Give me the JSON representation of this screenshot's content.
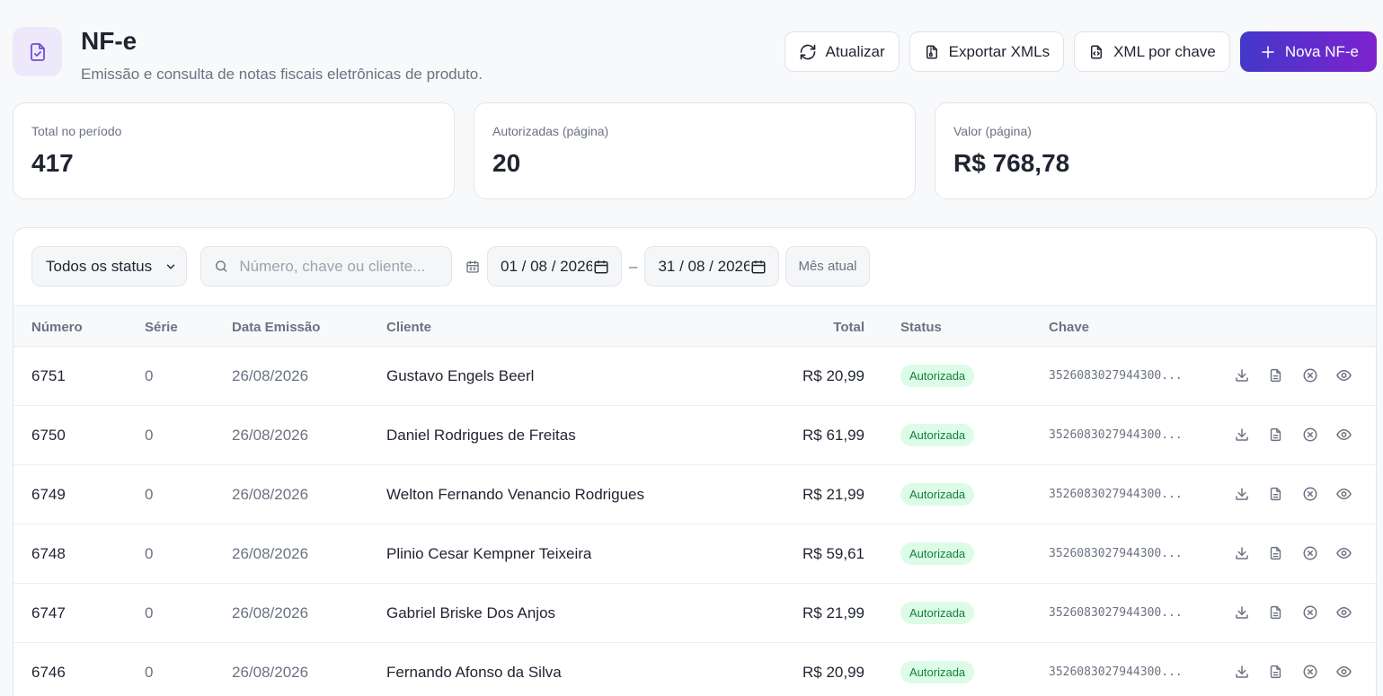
{
  "header": {
    "title": "NF-e",
    "subtitle": "Emissão e consulta de notas fiscais eletrônicas de produto.",
    "icon": "file-check-icon"
  },
  "actions": {
    "refresh_label": "Atualizar",
    "export_label": "Exportar XMLs",
    "xml_key_label": "XML por chave",
    "new_label": "Nova NF-e"
  },
  "stats": [
    {
      "label": "Total no período",
      "value": "417"
    },
    {
      "label": "Autorizadas (página)",
      "value": "20"
    },
    {
      "label": "Valor (página)",
      "value": "R$ 768,78"
    }
  ],
  "filters": {
    "status_selected": "Todos os status",
    "search_placeholder": "Número, chave ou cliente...",
    "date_from": "01 / 08 / 2026",
    "date_separator": "–",
    "date_to": "31 / 08 / 2026",
    "month_button": "Mês atual"
  },
  "table": {
    "columns": {
      "numero": "Número",
      "serie": "Série",
      "data": "Data Emissão",
      "cliente": "Cliente",
      "total": "Total",
      "status": "Status",
      "chave": "Chave"
    },
    "rows": [
      {
        "numero": "6751",
        "serie": "0",
        "data": "26/08/2026",
        "cliente": "Gustavo Engels Beerl",
        "total": "R$ 20,99",
        "status": "Autorizada",
        "chave": "3526083027944300..."
      },
      {
        "numero": "6750",
        "serie": "0",
        "data": "26/08/2026",
        "cliente": "Daniel Rodrigues de Freitas",
        "total": "R$ 61,99",
        "status": "Autorizada",
        "chave": "3526083027944300..."
      },
      {
        "numero": "6749",
        "serie": "0",
        "data": "26/08/2026",
        "cliente": "Welton Fernando Venancio Rodrigues",
        "total": "R$ 21,99",
        "status": "Autorizada",
        "chave": "3526083027944300..."
      },
      {
        "numero": "6748",
        "serie": "0",
        "data": "26/08/2026",
        "cliente": "Plinio Cesar Kempner Teixeira",
        "total": "R$ 59,61",
        "status": "Autorizada",
        "chave": "3526083027944300..."
      },
      {
        "numero": "6747",
        "serie": "0",
        "data": "26/08/2026",
        "cliente": "Gabriel Briske Dos Anjos",
        "total": "R$ 21,99",
        "status": "Autorizada",
        "chave": "3526083027944300..."
      },
      {
        "numero": "6746",
        "serie": "0",
        "data": "26/08/2026",
        "cliente": "Fernando Afonso da Silva",
        "total": "R$ 20,99",
        "status": "Autorizada",
        "chave": "3526083027944300..."
      }
    ]
  },
  "colors": {
    "accent_start": "#4338ca",
    "accent_end": "#7e22ce",
    "status_bg": "#dcfce7",
    "status_text": "#15803d"
  }
}
